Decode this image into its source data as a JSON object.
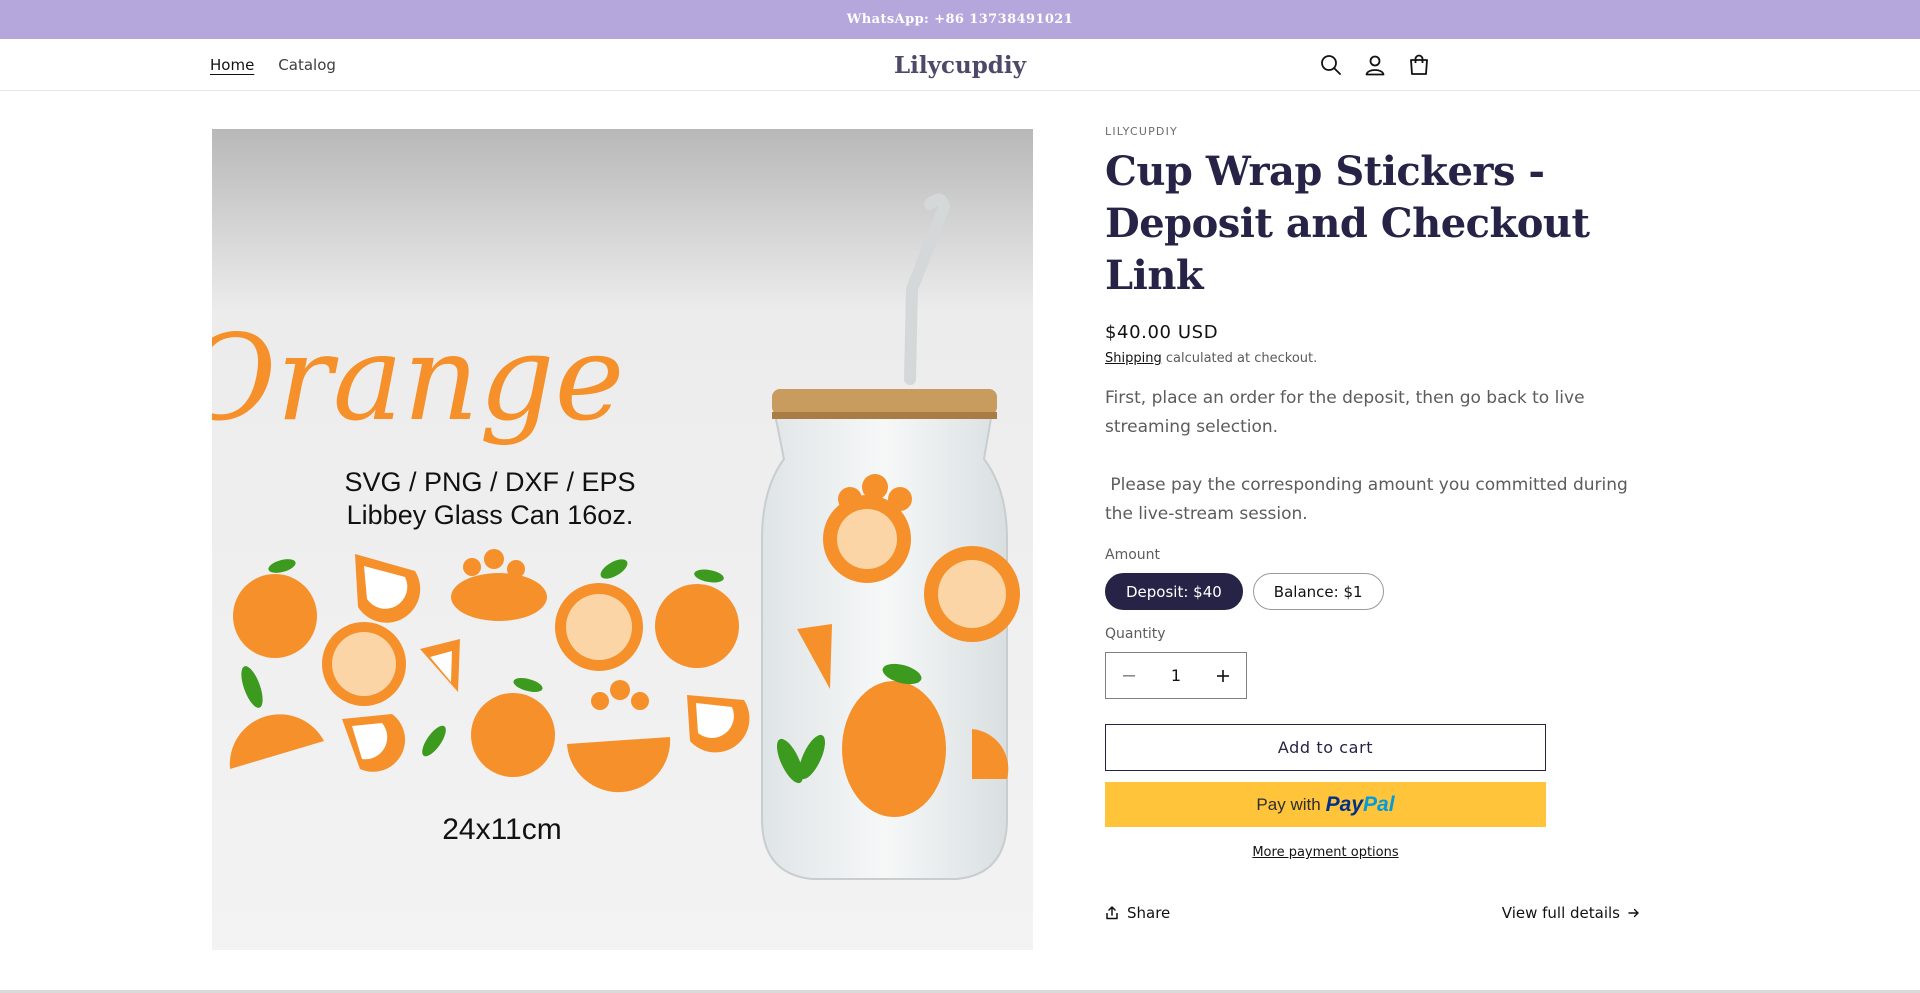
{
  "announcement": "WhatsApp: +86 13738491021",
  "header": {
    "nav": [
      {
        "label": "Home",
        "active": true
      },
      {
        "label": "Catalog",
        "active": false
      }
    ],
    "logo": "Lilycupdiy",
    "icons": [
      "search-icon",
      "account-icon",
      "cart-icon"
    ]
  },
  "product_image": {
    "script_title": "Orange",
    "formats": "SVG / PNG / DXF / EPS",
    "subtitle": "Libbey Glass Can 16oz.",
    "size": "24x11cm"
  },
  "product": {
    "vendor": "LILYCUPDIY",
    "title": "Cup Wrap Stickers - Deposit and Checkout Link",
    "price": "$40.00 USD",
    "shipping_link": "Shipping",
    "shipping_text": " calculated at checkout.",
    "description": [
      "First, place an order for the deposit, then go back to live streaming selection.",
      " Please pay the corresponding amount you committed during the live-stream session."
    ],
    "amount_label": "Amount",
    "amount_options": [
      {
        "label": "Deposit: $40",
        "selected": true
      },
      {
        "label": "Balance: $1",
        "selected": false
      }
    ],
    "quantity_label": "Quantity",
    "quantity_value": "1",
    "add_to_cart": "Add to cart",
    "paypal": {
      "prefix": "Pay with",
      "brand_1": "Pay",
      "brand_2": "Pal"
    },
    "more_payment": "More payment options",
    "share": "Share",
    "view_details": "View full details"
  },
  "colors": {
    "announcement_bg": "#b5a6dc",
    "accent": "#262347",
    "paypal": "#ffc439",
    "orange": "#f5902b",
    "leaf": "#3c9a1f"
  }
}
